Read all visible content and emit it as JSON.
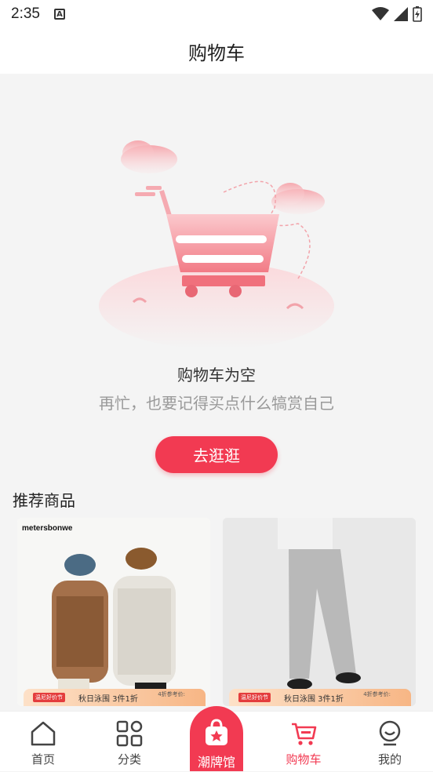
{
  "status_bar": {
    "time": "2:35",
    "notification_letter": "A"
  },
  "header": {
    "title": "购物车"
  },
  "empty_state": {
    "title": "购物车为空",
    "subtitle": "再忙，也要记得买点什么犒赏自己",
    "button_label": "去逛逛"
  },
  "recommend": {
    "title": "推荐商品",
    "products": [
      {
        "brand": "metersbonwe",
        "promo_tag": "温尼好价节",
        "promo_text": "秋日泳围 3件1折",
        "promo_ref": "4折参考价:"
      },
      {
        "brand": "",
        "promo_tag": "温尼好价节",
        "promo_text": "秋日泳围 3件1折",
        "promo_ref": "4折参考价:"
      }
    ]
  },
  "tabbar": {
    "home": "首页",
    "category": "分类",
    "center": "潮牌馆",
    "cart": "购物车",
    "mine": "我的"
  },
  "colors": {
    "accent": "#f23a52"
  }
}
